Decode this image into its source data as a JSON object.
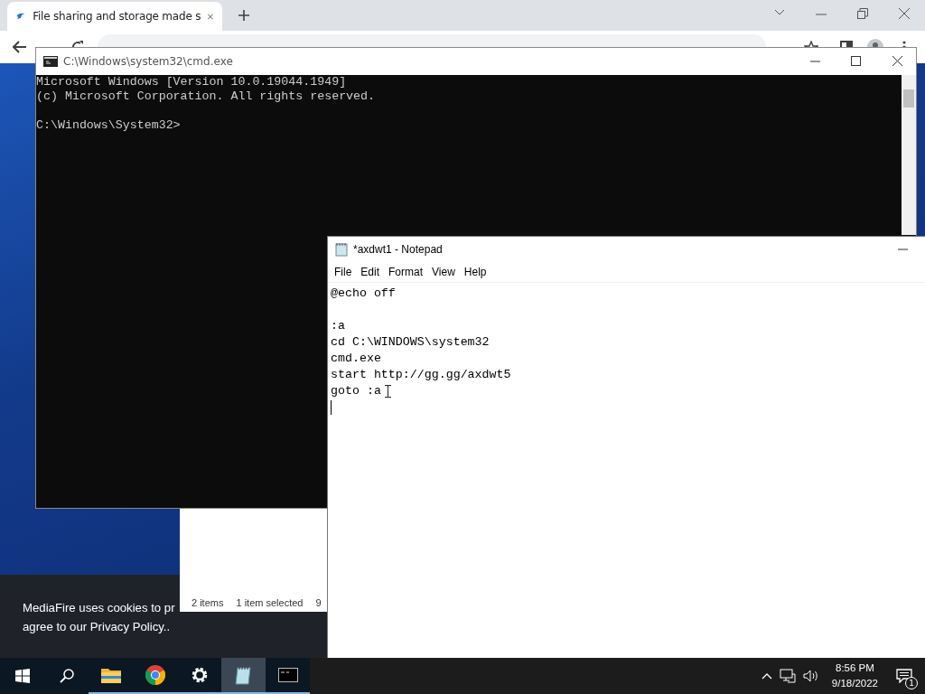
{
  "browser": {
    "tab": {
      "title": "File sharing and storage made s",
      "selected": true
    },
    "cookie_banner": [
      "MediaFire uses cookies to pr",
      "agree to our Privacy Policy.."
    ]
  },
  "cmd_window": {
    "title": "C:\\Windows\\system32\\cmd.exe",
    "lines": [
      {
        "kind": "text",
        "text": "Microsoft Windows [Version 10.0.19044.1949]"
      },
      {
        "kind": "text",
        "text": "(c) Microsoft Corporation. All rights reserved."
      },
      {
        "kind": "blank"
      },
      {
        "kind": "text",
        "text": "C:\\Windows\\System32>"
      }
    ]
  },
  "explorer_status": [
    "2 items",
    "1 item selected",
    "9"
  ],
  "notepad": {
    "title": "*axdwt1 - Notepad",
    "menu": [
      "File",
      "Edit",
      "Format",
      "View",
      "Help"
    ],
    "lines": [
      {
        "kind": "text",
        "text": "@echo off"
      },
      {
        "kind": "blank"
      },
      {
        "kind": "text",
        "text": ":a"
      },
      {
        "kind": "text",
        "text": "cd C:\\WINDOWS\\system32"
      },
      {
        "kind": "text",
        "text": "cmd.exe"
      },
      {
        "kind": "text",
        "text": "start http://gg.gg/axdwt5"
      },
      {
        "kind": "text",
        "text": "goto :a"
      }
    ]
  },
  "taskbar": {
    "apps": [
      {
        "kind": "start",
        "running": false,
        "active": false
      },
      {
        "kind": "search",
        "running": false,
        "active": false
      },
      {
        "kind": "folder",
        "running": true,
        "active": false
      },
      {
        "kind": "browser",
        "running": true,
        "active": false
      },
      {
        "kind": "settings",
        "running": true,
        "active": false
      },
      {
        "kind": "notepad",
        "running": true,
        "active": true
      },
      {
        "kind": "console",
        "running": true,
        "active": false
      }
    ],
    "time": "8:56 PM",
    "date": "9/18/2022",
    "notification_count": "1"
  }
}
